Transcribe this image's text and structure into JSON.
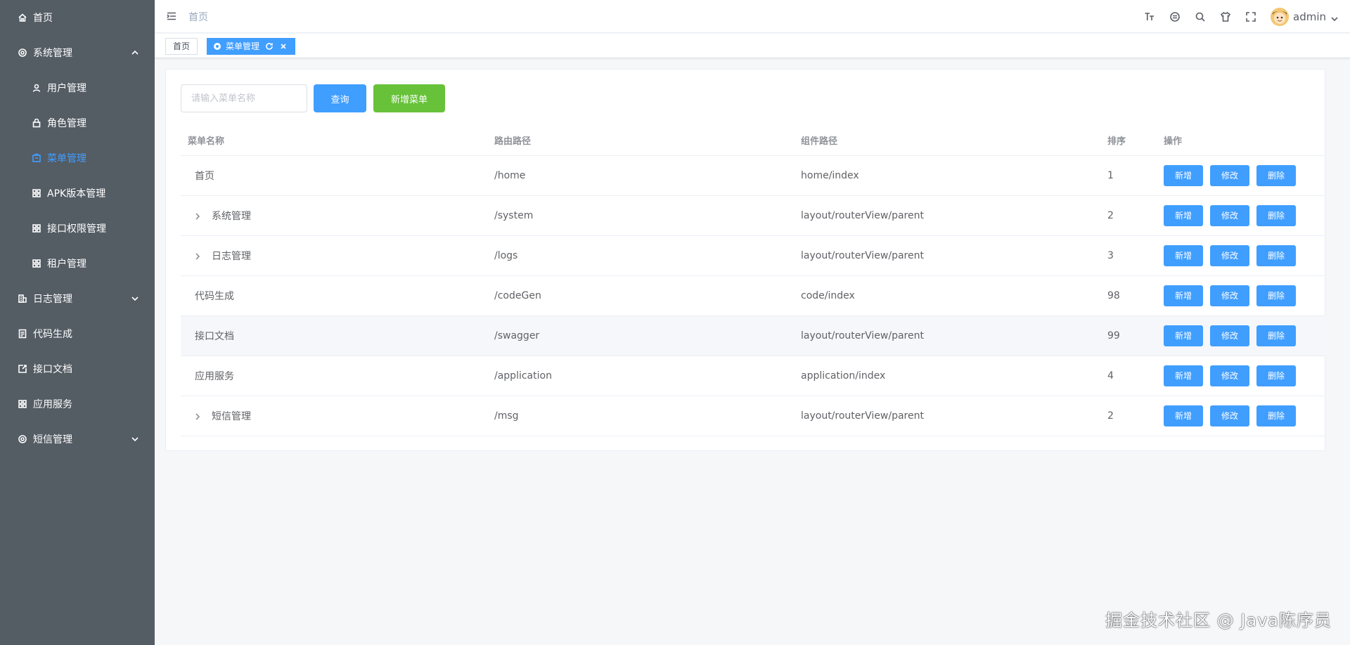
{
  "sidebar": {
    "items": [
      {
        "label": "首页",
        "icon": "home-icon"
      },
      {
        "label": "系统管理",
        "icon": "gear-icon",
        "expanded": true
      },
      {
        "label": "用户管理",
        "icon": "user-icon"
      },
      {
        "label": "角色管理",
        "icon": "lock-icon"
      },
      {
        "label": "菜单管理",
        "icon": "menu-box-icon",
        "active": true
      },
      {
        "label": "APK版本管理",
        "icon": "grid-icon"
      },
      {
        "label": "接口权限管理",
        "icon": "grid-icon"
      },
      {
        "label": "租户管理",
        "icon": "grid-icon"
      },
      {
        "label": "日志管理",
        "icon": "building-icon"
      },
      {
        "label": "代码生成",
        "icon": "document-icon"
      },
      {
        "label": "接口文档",
        "icon": "external-doc-icon"
      },
      {
        "label": "应用服务",
        "icon": "grid-icon"
      },
      {
        "label": "短信管理",
        "icon": "gear-icon"
      }
    ]
  },
  "header": {
    "breadcrumb": "首页",
    "username": "admin"
  },
  "tags": [
    {
      "label": "首页"
    },
    {
      "label": "菜单管理",
      "active": true
    }
  ],
  "search": {
    "placeholder": "请输入菜单名称",
    "query_label": "查询",
    "add_menu_label": "新增菜单"
  },
  "table": {
    "columns": [
      "菜单名称",
      "路由路径",
      "组件路径",
      "排序",
      "操作"
    ],
    "rows": [
      {
        "name": "首页",
        "path": "/home",
        "component": "home/index",
        "sort": "1",
        "expandable": false
      },
      {
        "name": "系统管理",
        "path": "/system",
        "component": "layout/routerView/parent",
        "sort": "2",
        "expandable": true
      },
      {
        "name": "日志管理",
        "path": "/logs",
        "component": "layout/routerView/parent",
        "sort": "3",
        "expandable": true
      },
      {
        "name": "代码生成",
        "path": "/codeGen",
        "component": "code/index",
        "sort": "98",
        "expandable": false
      },
      {
        "name": "接口文档",
        "path": "/swagger",
        "component": "layout/routerView/parent",
        "sort": "99",
        "expandable": false
      },
      {
        "name": "应用服务",
        "path": "/application",
        "component": "application/index",
        "sort": "4",
        "expandable": false
      },
      {
        "name": "短信管理",
        "path": "/msg",
        "component": "layout/routerView/parent",
        "sort": "2",
        "expandable": true
      }
    ],
    "actions": {
      "add": "新增",
      "edit": "修改",
      "delete": "删除"
    }
  },
  "watermark": "掘金技术社区 @ Java陈序员",
  "colors": {
    "primary": "#409eff",
    "success": "#67c23a",
    "sidebar_bg": "#545c64"
  }
}
